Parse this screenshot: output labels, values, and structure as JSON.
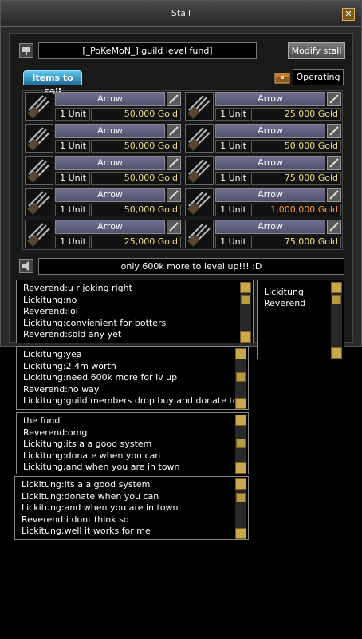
{
  "window": {
    "title": "Stall"
  },
  "header": {
    "stall_name": "[_PoKeMoN_] guild level fund]",
    "modify_label": "Modify stall",
    "tab_label": "Items to sell",
    "status_label": "Operating"
  },
  "items": [
    {
      "name": "Arrow",
      "qty": "1 Unit",
      "price": "50,000 Gold"
    },
    {
      "name": "Arrow",
      "qty": "1 Unit",
      "price": "25,000 Gold"
    },
    {
      "name": "Arrow",
      "qty": "1 Unit",
      "price": "50,000 Gold"
    },
    {
      "name": "Arrow",
      "qty": "1 Unit",
      "price": "50,000 Gold"
    },
    {
      "name": "Arrow",
      "qty": "1 Unit",
      "price": "50,000 Gold"
    },
    {
      "name": "Arrow",
      "qty": "1 Unit",
      "price": "75,000 Gold"
    },
    {
      "name": "Arrow",
      "qty": "1 Unit",
      "price": "50,000 Gold"
    },
    {
      "name": "Arrow",
      "qty": "1 Unit",
      "price": "1,000,000 Gold"
    },
    {
      "name": "Arrow",
      "qty": "1 Unit",
      "price": "25,000 Gold"
    },
    {
      "name": "Arrow",
      "qty": "1 Unit",
      "price": "75,000 Gold"
    }
  ],
  "stall_message": "only 600k more to level up!!! :D",
  "users": [
    "Lickitung",
    "Reverend"
  ],
  "chat_boxes": [
    {
      "lines": [
        "Reverend:u r joking right",
        "Lickitung:no",
        "Reverend:lol",
        "Lickitung:convienient for botters",
        "Reverend:sold any yet"
      ]
    },
    {
      "lines": [
        "Lickitung:yea",
        "Lickitung:2.4m worth",
        "Lickitung:need 600k more for lv up",
        "Reverend:no way",
        "Lickitung:guild members drop buy and donate to"
      ]
    },
    {
      "lines": [
        " the fund",
        "Reverend:omg",
        "Lickitung:its a a good system",
        "Lickitung:donate when you can",
        "Lickitung:and when you are in town"
      ]
    },
    {
      "lines": [
        "Lickitung:its a a good system",
        "Lickitung:donate when you can",
        "Lickitung:and when you are in town",
        "Reverend:i dont think so",
        "Lickitung:well it works for me"
      ]
    }
  ],
  "colors": {
    "price_normal": "#f0e080",
    "price_high": "#ff9a3a",
    "tab": "#3aa6d8"
  },
  "icons": {
    "close": "close-icon",
    "stall": "stall-icon",
    "chest": "chest-icon",
    "arrow": "arrow-bundle-icon",
    "edit": "pencil-icon",
    "speaker": "speaker-icon"
  }
}
